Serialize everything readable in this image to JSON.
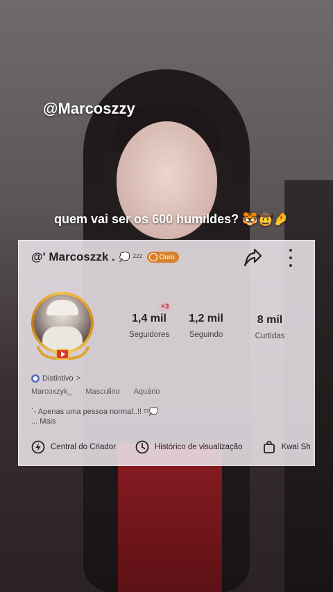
{
  "overlay": {
    "username_caption": "@Marcoszzy",
    "question_caption": "quem vai ser os 600 humildes? 🐯🤠🤌"
  },
  "profile": {
    "handle": "@' Marcoszzk .",
    "header_emoji": "💭 ᶻᶻᶻ",
    "tier_badge": "Ouro",
    "stats": [
      {
        "value": "1,4 mil",
        "label": "Seguidores",
        "delta": "+3"
      },
      {
        "value": "1,2 mil",
        "label": "Seguindo"
      },
      {
        "value": "8 mil",
        "label": "Curtidas"
      }
    ],
    "distintivo": "Distintivo",
    "distintivo_chevron": ">",
    "info": [
      "Marcoxzyk_",
      "Masculino",
      "Aquário"
    ],
    "bio_line1": "`- Apenas uma pessoa normal..!! ᶻᶻ💭",
    "bio_more": "...  Mais",
    "shortcuts": [
      "Central do Criador",
      "Histórico de visualização",
      "Kwai Sh"
    ]
  },
  "colors": {
    "badge": "#d9822b",
    "avatar_ring": "#f6c24a",
    "delta": "#c8243a"
  },
  "icons": {
    "share": "share-arrow-icon",
    "more": "more-vertical-icon",
    "creator": "lightning-icon",
    "history": "clock-icon",
    "shop": "shopping-bag-icon"
  }
}
